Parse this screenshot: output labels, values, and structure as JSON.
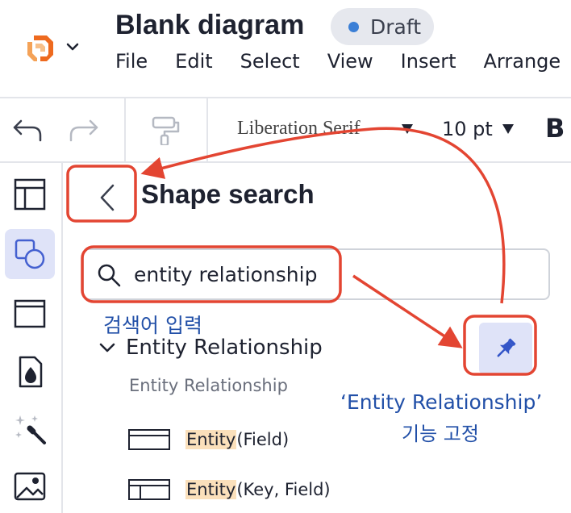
{
  "header": {
    "document_title": "Blank diagram",
    "status_badge": "Draft",
    "menu": [
      "File",
      "Edit",
      "Select",
      "View",
      "Insert",
      "Arrange"
    ]
  },
  "toolbar": {
    "font_family": "Liberation Serif",
    "font_size": "10 pt",
    "bold_label": "B"
  },
  "panel": {
    "title": "Shape search",
    "search": {
      "value": "entity relationship",
      "placeholder": ""
    },
    "section_label": "Entity Relationship",
    "sub_label": "Entity Relationship",
    "shapes": [
      {
        "highlight": "Entity",
        "rest": " (Field)"
      },
      {
        "highlight": "Entity",
        "rest": " (Key, Field)"
      }
    ]
  },
  "annotations": {
    "search_note": "검색어 입력",
    "pin_note_line1": "‘Entity Relationship’",
    "pin_note_line2": "기능 고정"
  },
  "colors": {
    "annotation_red": "#e34532",
    "annotation_text": "#2250a8",
    "active_accent": "#dfe3f8",
    "logo_orange": "#ee6a1f"
  }
}
